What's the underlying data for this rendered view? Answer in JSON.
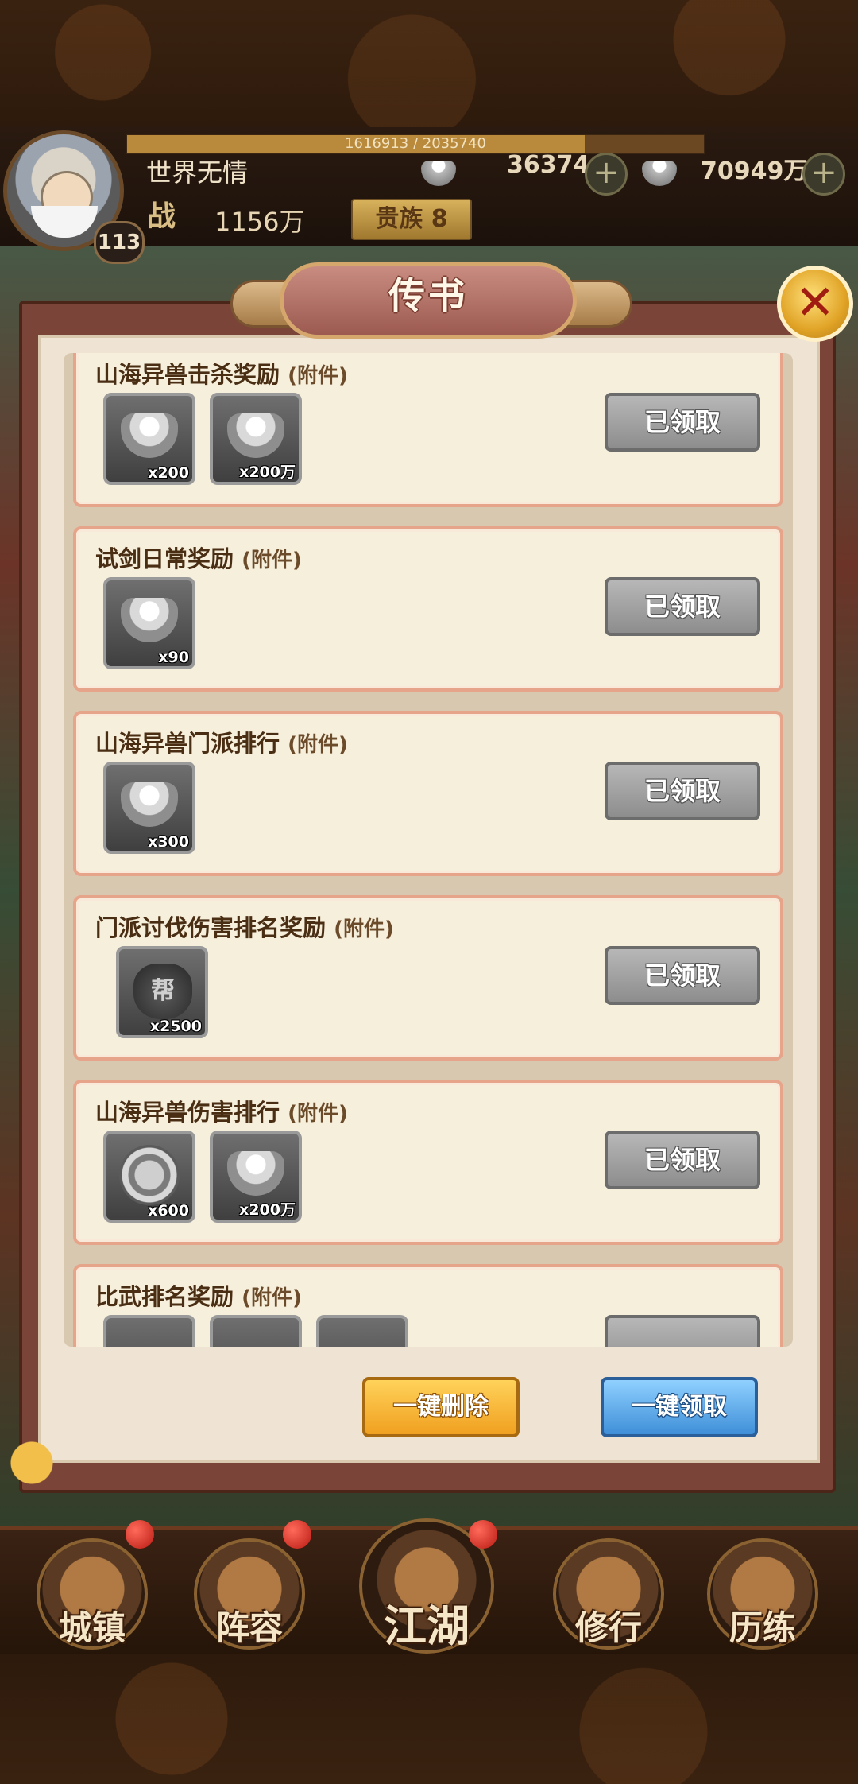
{
  "header": {
    "exp_text": "1616913 / 2035740",
    "exp_fraction": 0.794,
    "player_name": "世界无情",
    "level": "113",
    "gold_ingots": "36374",
    "silver_ingots": "70949万",
    "power_label": "战",
    "power_value": "1156万",
    "vip_text": "贵族 8"
  },
  "dialog": {
    "title": "传书",
    "tag": "(附件)",
    "claimed_label": "已领取",
    "delete_all_label": "一键删除",
    "claim_all_label": "一键领取",
    "mails": [
      {
        "title": "山海异兽击杀奖励",
        "items": [
          {
            "icon": "silver-ingot",
            "qty": "x200"
          },
          {
            "icon": "silver-ingot",
            "qty": "x200万"
          }
        ]
      },
      {
        "title": "试剑日常奖励",
        "items": [
          {
            "icon": "silver-ingot",
            "qty": "x90"
          }
        ]
      },
      {
        "title": "山海异兽门派排行",
        "items": [
          {
            "icon": "silver-ingot",
            "qty": "x300"
          }
        ]
      },
      {
        "title": "门派讨伐伤害排名奖励",
        "items": [
          {
            "icon": "guild-bag",
            "qty": "x2500"
          }
        ]
      },
      {
        "title": "山海异兽伤害排行",
        "items": [
          {
            "icon": "silver-coin",
            "qty": "x600"
          },
          {
            "icon": "silver-ingot",
            "qty": "x200万"
          }
        ]
      },
      {
        "title": "比武排名奖励",
        "items": []
      }
    ]
  },
  "nav": {
    "items": [
      "城镇",
      "阵容",
      "江湖",
      "修行",
      "历练"
    ]
  },
  "glyphs": {
    "guild_bag": "帮",
    "close": "✕",
    "plus": "+"
  },
  "colors": {
    "dialog_frame": "#7a4538",
    "card_border": "#e6a58a",
    "claimed_gray": "#9a9a9a",
    "delete_orange": "#f0a020",
    "claim_blue": "#3f8fd8"
  }
}
